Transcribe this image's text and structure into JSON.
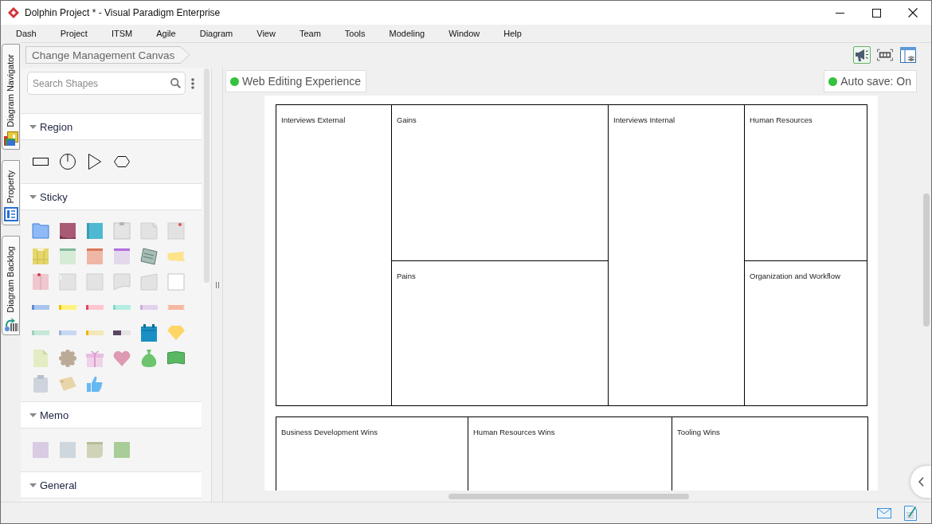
{
  "window": {
    "title": "Dolphin Project * - Visual Paradigm Enterprise"
  },
  "menu": [
    "Dash",
    "Project",
    "ITSM",
    "Agile",
    "Diagram",
    "View",
    "Team",
    "Tools",
    "Modeling",
    "Window",
    "Help"
  ],
  "side_tabs": [
    {
      "label": "Diagram Navigator",
      "kind": "navigator"
    },
    {
      "label": "Property",
      "kind": "property"
    },
    {
      "label": "Diagram Backlog",
      "kind": "backlog"
    }
  ],
  "breadcrumb": [
    "Change Management Canvas"
  ],
  "toolbar": [
    {
      "kind": "megaphone",
      "selected": true
    },
    {
      "kind": "fit",
      "selected": false
    },
    {
      "kind": "layout",
      "selected": false
    }
  ],
  "shape_panel": {
    "search": {
      "placeholder": "Search Shapes"
    },
    "sections": [
      {
        "title": "Region",
        "kind": "region",
        "expanded": true
      },
      {
        "title": "Sticky",
        "kind": "sticky",
        "expanded": true
      },
      {
        "title": "Memo",
        "kind": "memo",
        "expanded": true
      },
      {
        "title": "General",
        "kind": "general",
        "expanded": true
      }
    ]
  },
  "canvas": {
    "badges": [
      {
        "label": "Web Editing Experience",
        "on": true
      },
      {
        "label": "Auto save: On",
        "on": true
      }
    ],
    "top_grid": [
      {
        "cells": [
          "Interviews External"
        ]
      },
      {
        "cells": [
          "Gains",
          "Pains"
        ]
      },
      {
        "cells": [
          "Interviews Internal"
        ]
      },
      {
        "cells": [
          "Human Resources",
          "Organization and Workflow"
        ]
      }
    ],
    "bottom_grid": [
      {
        "cells": [
          "Business Development Wins"
        ]
      },
      {
        "cells": [
          "Human Resources Wins"
        ]
      },
      {
        "cells": [
          "Tooling Wins"
        ]
      }
    ]
  }
}
